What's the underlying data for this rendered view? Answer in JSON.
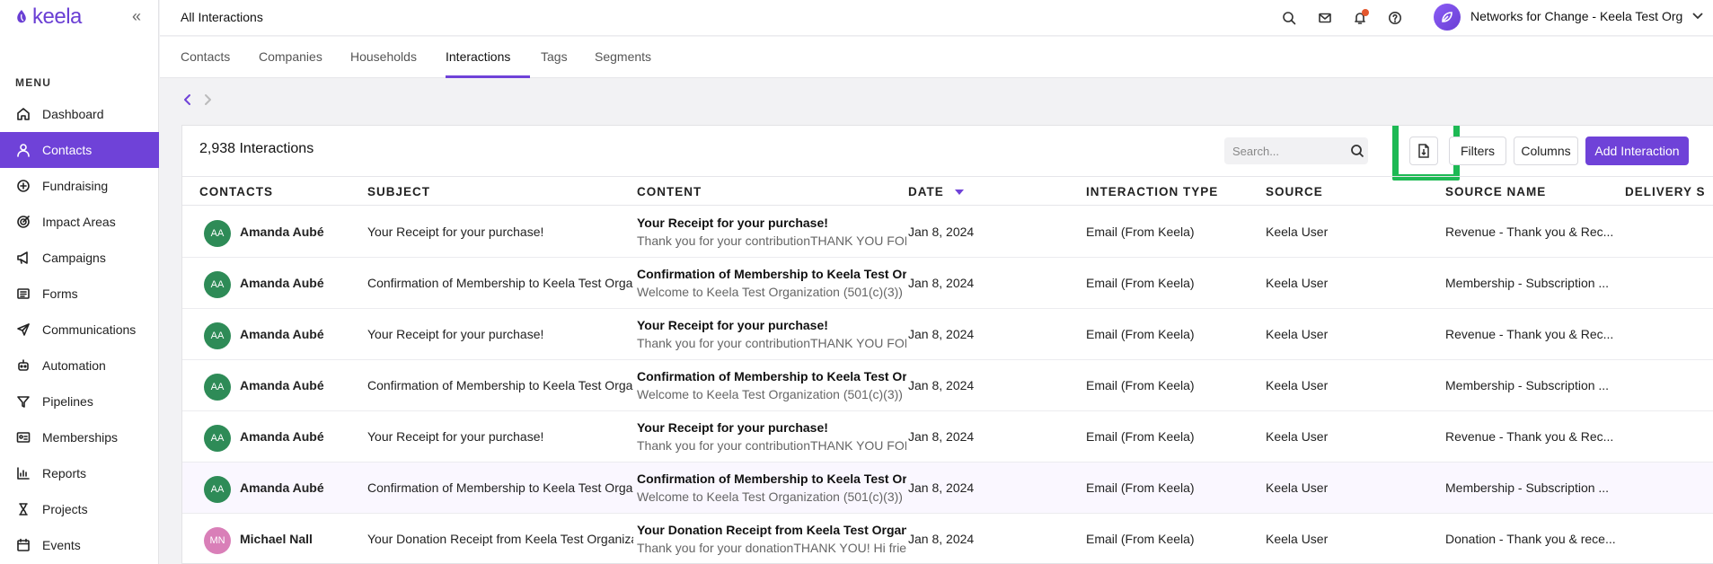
{
  "brand": {
    "name": "keela",
    "accent": "#6f42d8"
  },
  "sidebar": {
    "menu_label": "MENU",
    "collapse_icon": "double-chevron-left-icon",
    "items": [
      {
        "label": "Dashboard",
        "icon": "home-icon"
      },
      {
        "label": "Contacts",
        "icon": "user-icon",
        "active": true
      },
      {
        "label": "Fundraising",
        "icon": "donation-icon"
      },
      {
        "label": "Impact Areas",
        "icon": "target-icon"
      },
      {
        "label": "Campaigns",
        "icon": "megaphone-icon"
      },
      {
        "label": "Forms",
        "icon": "form-icon"
      },
      {
        "label": "Communications",
        "icon": "send-icon"
      },
      {
        "label": "Automation",
        "icon": "robot-icon"
      },
      {
        "label": "Pipelines",
        "icon": "funnel-icon"
      },
      {
        "label": "Memberships",
        "icon": "id-card-icon"
      },
      {
        "label": "Reports",
        "icon": "chart-icon"
      },
      {
        "label": "Projects",
        "icon": "hourglass-icon"
      },
      {
        "label": "Events",
        "icon": "calendar-icon"
      }
    ]
  },
  "header": {
    "title": "All Interactions",
    "org_name": "Networks for Change - Keela Test Org"
  },
  "tabs": [
    {
      "label": "Contacts"
    },
    {
      "label": "Companies"
    },
    {
      "label": "Households"
    },
    {
      "label": "Interactions",
      "active": true
    },
    {
      "label": "Tags"
    },
    {
      "label": "Segments"
    }
  ],
  "toolbar": {
    "count_label": "2,938 Interactions",
    "search_placeholder": "Search...",
    "filters_label": "Filters",
    "columns_label": "Columns",
    "add_label": "Add Interaction"
  },
  "table": {
    "columns": [
      "CONTACTS",
      "SUBJECT",
      "CONTENT",
      "DATE",
      "INTERACTION TYPE",
      "SOURCE",
      "SOURCE NAME",
      "DELIVERY S"
    ],
    "rows": [
      {
        "initials": "AA",
        "avatar_color": "#2e8b57",
        "contact": "Amanda Aubé",
        "subject": "Your Receipt for your purchase!",
        "content_title": "Your Receipt for your purchase!",
        "content_body": "Thank you for your contributionTHANK YOU FOR",
        "date": "Jan 8, 2024",
        "type": "Email (From Keela)",
        "source": "Keela User",
        "source_name": "Revenue - Thank you & Rec..."
      },
      {
        "initials": "AA",
        "avatar_color": "#2e8b57",
        "contact": "Amanda Aubé",
        "subject": "Confirmation of Membership to Keela Test Organization",
        "content_title": "Confirmation of Membership to Keela Test Organization",
        "content_body": "Welcome to Keela Test Organization (501(c)(3))",
        "date": "Jan 8, 2024",
        "type": "Email (From Keela)",
        "source": "Keela User",
        "source_name": "Membership - Subscription ..."
      },
      {
        "initials": "AA",
        "avatar_color": "#2e8b57",
        "contact": "Amanda Aubé",
        "subject": "Your Receipt for your purchase!",
        "content_title": "Your Receipt for your purchase!",
        "content_body": "Thank you for your contributionTHANK YOU FOR",
        "date": "Jan 8, 2024",
        "type": "Email (From Keela)",
        "source": "Keela User",
        "source_name": "Revenue - Thank you & Rec..."
      },
      {
        "initials": "AA",
        "avatar_color": "#2e8b57",
        "contact": "Amanda Aubé",
        "subject": "Confirmation of Membership to Keela Test Organization",
        "content_title": "Confirmation of Membership to Keela Test Organization",
        "content_body": "Welcome to Keela Test Organization (501(c)(3))",
        "date": "Jan 8, 2024",
        "type": "Email (From Keela)",
        "source": "Keela User",
        "source_name": "Membership - Subscription ..."
      },
      {
        "initials": "AA",
        "avatar_color": "#2e8b57",
        "contact": "Amanda Aubé",
        "subject": "Your Receipt for your purchase!",
        "content_title": "Your Receipt for your purchase!",
        "content_body": "Thank you for your contributionTHANK YOU FOR",
        "date": "Jan 8, 2024",
        "type": "Email (From Keela)",
        "source": "Keela User",
        "source_name": "Revenue - Thank you & Rec..."
      },
      {
        "initials": "AA",
        "avatar_color": "#2e8b57",
        "contact": "Amanda Aubé",
        "subject": "Confirmation of Membership to Keela Test Organization",
        "content_title": "Confirmation of Membership to Keela Test Organization",
        "content_body": "Welcome to Keela Test Organization (501(c)(3))",
        "date": "Jan 8, 2024",
        "type": "Email (From Keela)",
        "source": "Keela User",
        "source_name": "Membership - Subscription ..."
      },
      {
        "initials": "MN",
        "avatar_color": "#d97fb8",
        "contact": "Michael Nall",
        "subject": "Your Donation Receipt from Keela Test Organization",
        "content_title": "Your Donation Receipt from Keela Test Organization",
        "content_body": "Thank you for your donationTHANK YOU! Hi friend",
        "date": "Jan 8, 2024",
        "type": "Email (From Keela)",
        "source": "Keela User",
        "source_name": "Donation - Thank you & rece..."
      }
    ]
  }
}
